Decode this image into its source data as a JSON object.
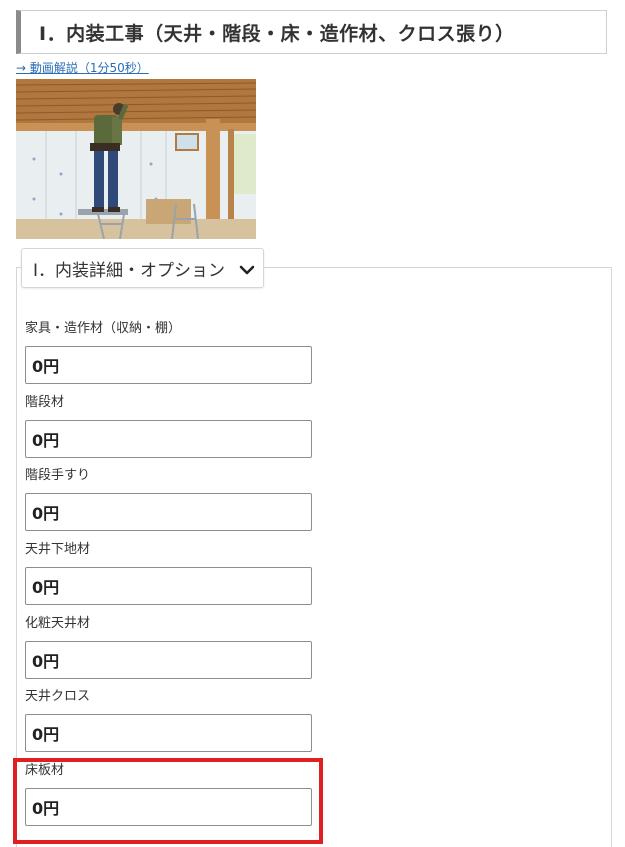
{
  "section": {
    "heading": "Ⅰ．内装工事（天井・階段・床・造作材、クロス張り）",
    "video_link": "→ 動画解説（1分50秒）"
  },
  "photo": {
    "subject": "worker-installing-ceiling"
  },
  "details": {
    "toggle_label": "Ⅰ．内装詳細・オプション",
    "toggle_icon": "chevron-down-icon"
  },
  "fields": [
    {
      "label": "家具・造作材（収納・棚）",
      "value": "0円"
    },
    {
      "label": "階段材",
      "value": "0円"
    },
    {
      "label": "階段手すり",
      "value": "0円"
    },
    {
      "label": "天井下地材",
      "value": "0円"
    },
    {
      "label": "化粧天井材",
      "value": "0円"
    },
    {
      "label": "天井クロス",
      "value": "0円"
    },
    {
      "label": "床板材",
      "value": "0円"
    }
  ],
  "colors": {
    "link": "#2a6db6",
    "highlight": "#e02020",
    "heading_bar": "#8a8a8a"
  }
}
